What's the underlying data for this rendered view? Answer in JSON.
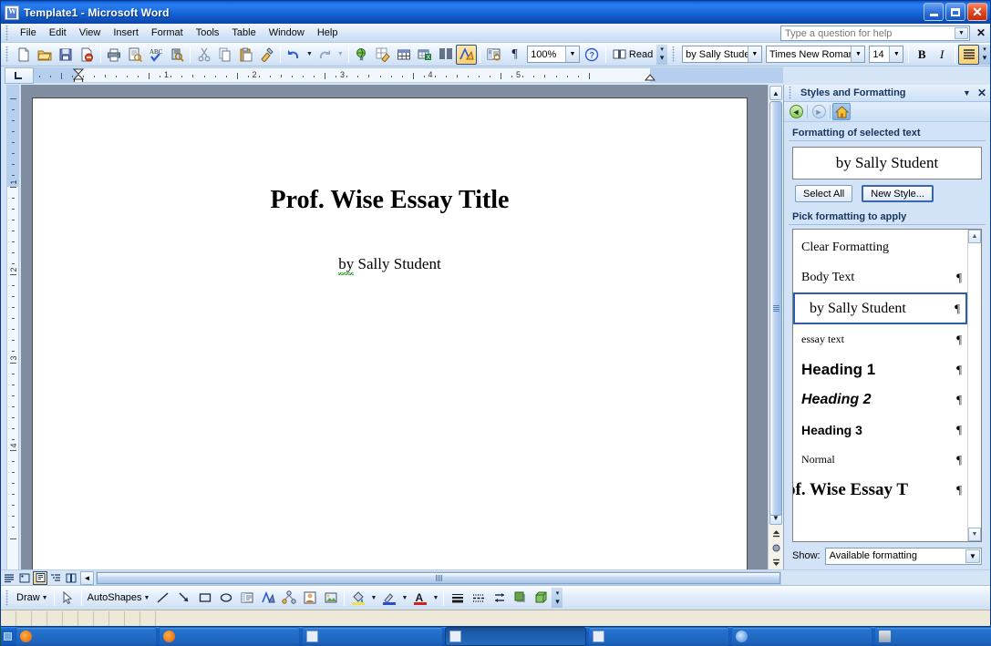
{
  "window": {
    "title": "Template1 - Microsoft Word",
    "app_icon": "word-document-icon",
    "minimize": "–",
    "maximize": "□",
    "close": "✕"
  },
  "menu": {
    "items": [
      {
        "label": "File"
      },
      {
        "label": "Edit"
      },
      {
        "label": "View"
      },
      {
        "label": "Insert"
      },
      {
        "label": "Format"
      },
      {
        "label": "Tools"
      },
      {
        "label": "Table"
      },
      {
        "label": "Window"
      },
      {
        "label": "Help"
      }
    ],
    "help_box_placeholder": "Type a question for help",
    "close_label": "✕"
  },
  "standard_toolbar": {
    "buttons": [
      {
        "name": "new-document-icon",
        "tip": "New Blank Document"
      },
      {
        "name": "open-icon",
        "tip": "Open"
      },
      {
        "name": "save-icon",
        "tip": "Save"
      },
      {
        "name": "permission-icon",
        "tip": "Permission"
      },
      {
        "name": "print-icon",
        "tip": "Print"
      },
      {
        "name": "print-preview-icon",
        "tip": "Print Preview"
      },
      {
        "name": "spelling-grammar-icon",
        "tip": "Spelling and Grammar"
      },
      {
        "name": "research-icon",
        "tip": "Research"
      },
      {
        "name": "cut-icon",
        "tip": "Cut"
      },
      {
        "name": "copy-icon",
        "tip": "Copy"
      },
      {
        "name": "paste-icon",
        "tip": "Paste"
      },
      {
        "name": "format-painter-icon",
        "tip": "Format Painter"
      },
      {
        "name": "undo-icon",
        "tip": "Undo"
      },
      {
        "name": "redo-icon",
        "tip": "Redo"
      },
      {
        "name": "hyperlink-icon",
        "tip": "Insert Hyperlink"
      },
      {
        "name": "tables-borders-icon",
        "tip": "Tables and Borders"
      },
      {
        "name": "insert-table-icon",
        "tip": "Insert Table"
      },
      {
        "name": "insert-excel-table-icon",
        "tip": "Insert Microsoft Excel Worksheet"
      },
      {
        "name": "columns-icon",
        "tip": "Columns"
      },
      {
        "name": "drawing-icon",
        "tip": "Drawing",
        "active": true
      },
      {
        "name": "document-map-icon",
        "tip": "Document Map"
      },
      {
        "name": "show-formatting-marks-icon",
        "tip": "Show/Hide ¶"
      }
    ],
    "zoom_value": "100%",
    "help_icon": "help-question-icon",
    "read_label": "Read",
    "read_icon": "read-book-icon"
  },
  "formatting_toolbar": {
    "style_value": "by Sally Studer",
    "font_value": "Times New Roman",
    "size_value": "14",
    "bold_label": "B",
    "italic_label": "I",
    "align_active": "justify-icon"
  },
  "ruler": {
    "tab_stop_icon": "left-tab-stop",
    "horizontal_numbers": [
      "1",
      "1",
      "2",
      "3",
      "4",
      "5"
    ],
    "vertical_numbers": [
      "1",
      "1",
      "2",
      "3",
      "4"
    ],
    "first_line_indent_icon": "first-line-indent-marker",
    "right_indent_icon": "right-indent-marker"
  },
  "document": {
    "title": "Prof. Wise Essay Title",
    "author": "by Sally Student",
    "author_squiggle_word": "by"
  },
  "task_pane": {
    "title": "Styles and Formatting",
    "dropdown_icon": "chevron-down-icon",
    "close_icon": "close-icon",
    "nav": {
      "back": "back-arrow-icon",
      "forward": "forward-arrow-icon",
      "home": "home-icon"
    },
    "selected_text_label": "Formatting of selected text",
    "selected_text_value": "by Sally Student",
    "select_all_label": "Select All",
    "new_style_label": "New Style...",
    "pick_formatting_label": "Pick formatting to apply",
    "styles": [
      {
        "label": "Clear Formatting",
        "mark": "",
        "class": "st-clear",
        "selected": false
      },
      {
        "label": "Body Text",
        "mark": "¶",
        "class": "st-body",
        "selected": false
      },
      {
        "label": "by Sally Student",
        "mark": "¶",
        "class": "st-sally",
        "selected": true
      },
      {
        "label": "essay text",
        "mark": "¶",
        "class": "st-essay",
        "selected": false
      },
      {
        "label": "Heading 1",
        "mark": "¶",
        "class": "st-h1",
        "selected": false
      },
      {
        "label": "Heading 2",
        "mark": "¶",
        "class": "st-h2",
        "selected": false
      },
      {
        "label": "Heading 3",
        "mark": "¶",
        "class": "st-h3",
        "selected": false
      },
      {
        "label": "Normal",
        "mark": "¶",
        "class": "st-normal",
        "selected": false
      },
      {
        "label": "of. Wise Essay T",
        "mark": "¶",
        "class": "st-prof",
        "selected": false
      }
    ],
    "scroll_up_icon": "scroll-up-arrow",
    "scroll_down_icon": "scroll-down-arrow",
    "show_label": "Show:",
    "show_value": "Available formatting"
  },
  "view_bar": {
    "buttons": [
      {
        "name": "normal-view-icon",
        "active": false
      },
      {
        "name": "web-layout-view-icon",
        "active": false
      },
      {
        "name": "print-layout-view-icon",
        "active": true
      },
      {
        "name": "outline-view-icon",
        "active": false
      },
      {
        "name": "reading-layout-view-icon",
        "active": false
      }
    ],
    "scroll_left_icon": "scroll-left-arrow"
  },
  "scrollbar": {
    "up_icon": "scroll-up-arrow",
    "down_icon": "scroll-down-arrow",
    "previous_page_icon": "previous-page-icon",
    "select_browse_object_icon": "select-browse-object-icon",
    "next_page_icon": "next-page-icon"
  },
  "drawing_toolbar": {
    "draw_label": "Draw",
    "autoshapes_label": "AutoShapes",
    "buttons": [
      {
        "name": "select-objects-icon"
      },
      {
        "name": "line-icon"
      },
      {
        "name": "arrow-icon"
      },
      {
        "name": "rectangle-icon"
      },
      {
        "name": "oval-icon"
      },
      {
        "name": "text-box-icon"
      },
      {
        "name": "wordart-icon"
      },
      {
        "name": "diagram-icon"
      },
      {
        "name": "clip-art-icon"
      },
      {
        "name": "picture-icon"
      },
      {
        "name": "fill-color-icon"
      },
      {
        "name": "line-color-icon"
      },
      {
        "name": "font-color-icon"
      },
      {
        "name": "line-style-icon"
      },
      {
        "name": "dash-style-icon"
      },
      {
        "name": "arrow-style-icon"
      },
      {
        "name": "shadow-style-icon"
      },
      {
        "name": "3d-style-icon"
      }
    ]
  },
  "taskbar": {
    "start_label": "",
    "tasks": [
      {
        "label": "",
        "icon": "ff"
      },
      {
        "label": "",
        "icon": "ff"
      },
      {
        "label": "",
        "icon": "word"
      },
      {
        "label": "",
        "icon": "word",
        "active": true
      },
      {
        "label": "",
        "icon": "word"
      },
      {
        "label": "",
        "icon": "blue"
      },
      {
        "label": "",
        "icon": "gray"
      },
      {
        "label": "",
        "icon": "cyan"
      }
    ]
  },
  "colors": {
    "title_blue": "#1565d8",
    "toolbar_blue": "#d6e5f5",
    "selection_border": "#2d5fa8",
    "active_button": "#f9cf70",
    "page_white": "#ffffff",
    "desk_gray": "#808ca0"
  }
}
